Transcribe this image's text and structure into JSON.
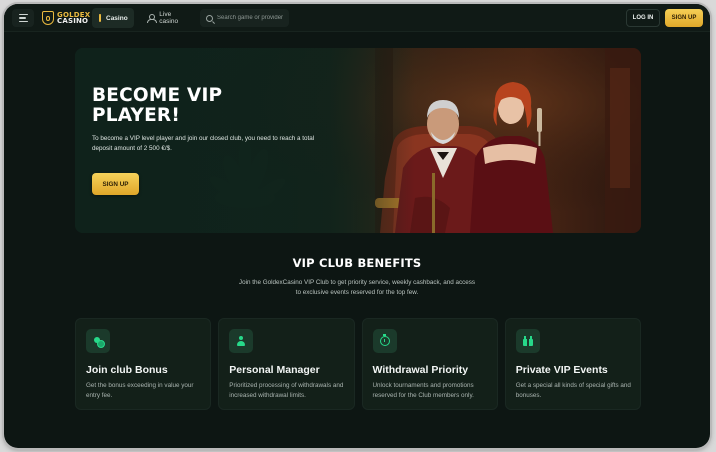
{
  "header": {
    "logo_line1": "GOLDEX",
    "logo_line2": "CASINO",
    "tabs": [
      {
        "label": "Casino",
        "icon": "club-icon",
        "active": true
      },
      {
        "label": "Live casino",
        "icon": "user-icon",
        "active": false
      }
    ],
    "search_placeholder": "Search game or provider",
    "login_label": "LOG IN",
    "signup_label": "SIGN UP"
  },
  "hero": {
    "title": "BECOME VIP PLAYER!",
    "description": "To become a VIP level player and join our closed club, you need to reach a total deposit amount of 2 500 €/$.",
    "button_label": "SIGN UP"
  },
  "benefits": {
    "title": "VIP CLUB BENEFITS",
    "description": "Join the GoldexCasino VIP Club to get priority service, weekly cashback, and access to exclusive events reserved for the top few.",
    "cards": [
      {
        "icon": "coins-icon",
        "title": "Join club Bonus",
        "description": "Get the bonus exceeding in value your entry fee."
      },
      {
        "icon": "manager-icon",
        "title": "Personal Manager",
        "description": "Prioritized processing of withdrawals and increased withdrawal limits."
      },
      {
        "icon": "stopwatch-icon",
        "title": "Withdrawal Priority",
        "description": "Unlock tournaments and promotions reserved for the Club members only."
      },
      {
        "icon": "gift-icon",
        "title": "Private VIP Events",
        "description": "Get a special all kinds of special gifts and bonuses."
      }
    ]
  },
  "colors": {
    "background": "#0d1613",
    "gold_accent": "#e9b93f",
    "green_accent": "#27d98a"
  }
}
